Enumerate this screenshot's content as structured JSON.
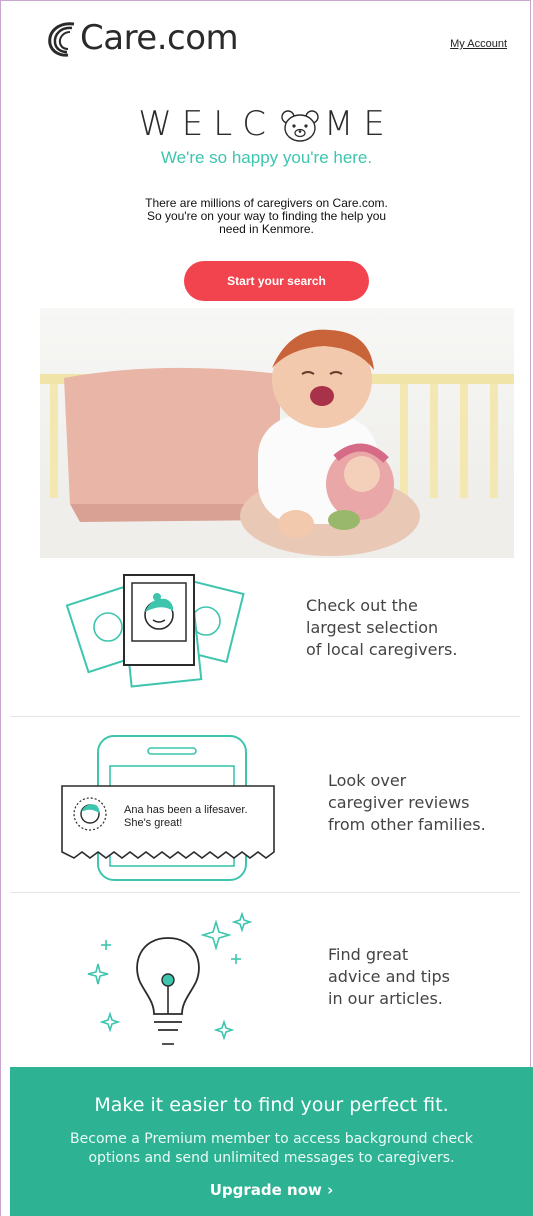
{
  "header": {
    "logo_text": "Care.com",
    "account_link": "My Account"
  },
  "welcome": {
    "letters_left": "WELC",
    "letters_right": "ME",
    "tagline": "We're so happy you're here."
  },
  "intro": {
    "line1": "There are millions of caregivers on Care.com.",
    "line2": "So you're on your way to finding the help you",
    "line3": "need in Kenmore."
  },
  "cta": {
    "label": "Start your search"
  },
  "features": [
    {
      "icon": "caregiver-photos-icon",
      "line1": "Check out the",
      "line2": "largest selection",
      "line3": "of local caregivers."
    },
    {
      "icon": "phone-review-icon",
      "review_line1": "Ana has been a lifesaver.",
      "review_line2": "She's great!",
      "line1": "Look over",
      "line2": "caregiver reviews",
      "line3": "from other families."
    },
    {
      "icon": "lightbulb-icon",
      "line1": "Find great",
      "line2": "advice and tips",
      "line3": "in our articles."
    }
  ],
  "promo": {
    "title": "Make it easier to find your perfect fit.",
    "body_line1": "Become a Premium member to access background check",
    "body_line2": "options and send unlimited messages to caregivers.",
    "link": "Upgrade now ›"
  },
  "colors": {
    "accent": "#3dc5ae",
    "cta": "#f2444e",
    "promo_bg": "#2db394"
  }
}
